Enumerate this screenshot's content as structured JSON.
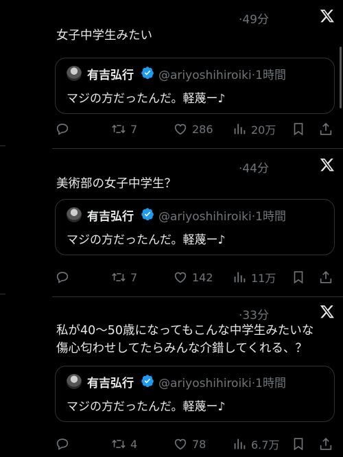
{
  "posts": [
    {
      "time": "·49分",
      "text": "女子中学生みたい",
      "quote": {
        "name": "有吉弘行",
        "handle": "@ariyoshihiroiki",
        "time": "·1時間",
        "text": "マジの方だったんだ。軽蔑ー♪"
      },
      "retweets": "7",
      "likes": "286",
      "views": "20万"
    },
    {
      "time": "·44分",
      "text": "美術部の女子中学生？",
      "quote": {
        "name": "有吉弘行",
        "handle": "@ariyoshihiroiki",
        "time": "·1時間",
        "text": "マジの方だったんだ。軽蔑ー♪"
      },
      "retweets": "7",
      "likes": "142",
      "views": "11万"
    },
    {
      "time": "·33分",
      "text_line1": "私が40〜50歳になってもこんな中学生みたいな",
      "text_line2": "傷心匂わせしてたらみんな介錯してくれる、？",
      "quote": {
        "name": "有吉弘行",
        "handle": "@ariyoshihiroiki",
        "time": "·1時間",
        "text": "マジの方だったんだ。軽蔑ー♪"
      },
      "retweets": "4",
      "likes": "78",
      "views": "6.7万"
    }
  ],
  "icons": [
    "x-logo-icon",
    "verified-badge-icon",
    "reply-icon",
    "retweet-icon",
    "like-icon",
    "views-icon",
    "bookmark-icon",
    "share-icon"
  ],
  "colors": {
    "background": "#000000",
    "text": "#e7e9ea",
    "secondary": "#71767b",
    "border": "#2f3336",
    "verified": "#1d9bf0"
  }
}
